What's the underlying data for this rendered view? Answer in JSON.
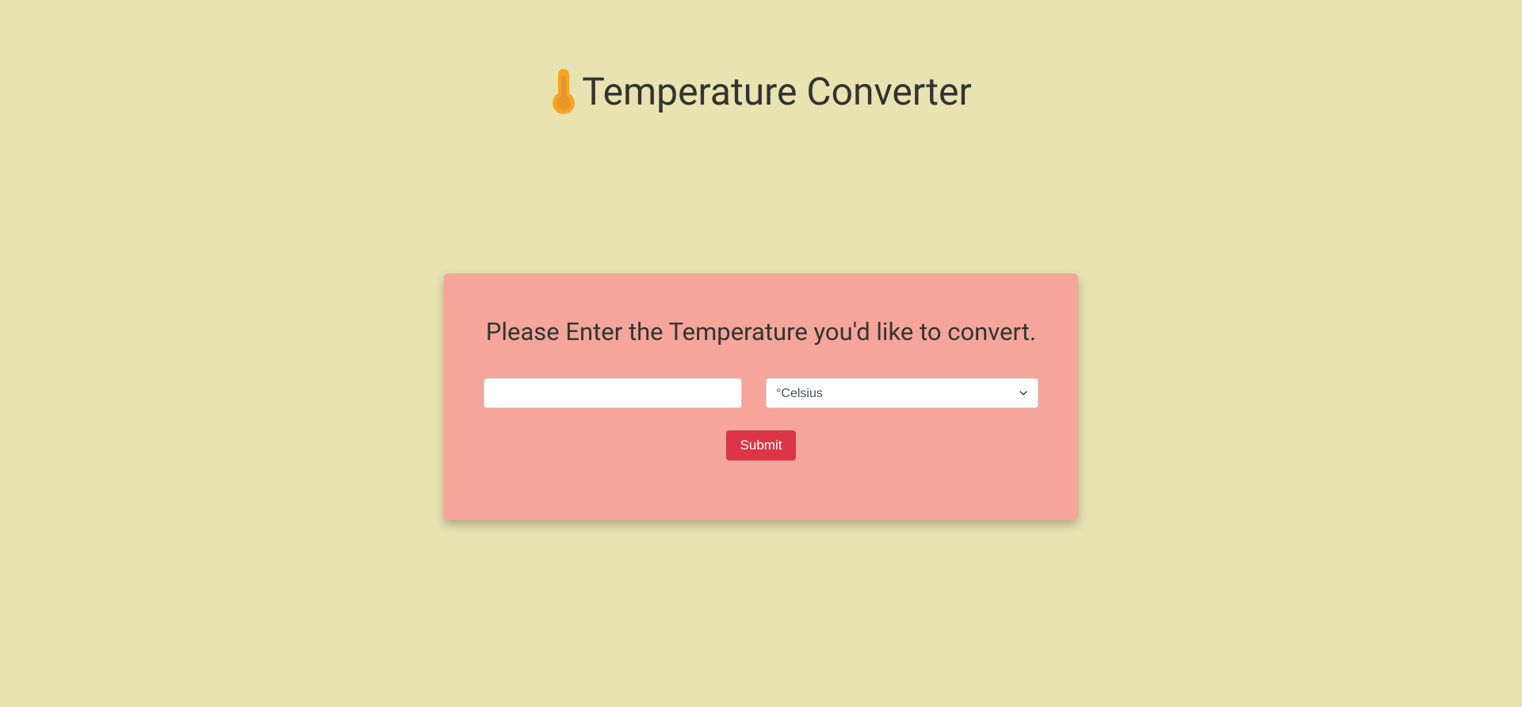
{
  "header": {
    "title": " Temperature Converter"
  },
  "card": {
    "prompt": "Please Enter the Temperature you'd like to convert.",
    "input_value": "",
    "select_value": "°Celsius",
    "submit_label": "Submit"
  },
  "icons": {
    "thermometer": "thermometer-icon"
  },
  "colors": {
    "background": "#e8e3b0",
    "card": "#f5a59a",
    "button": "#dc3545",
    "icon": "#f5a623"
  }
}
